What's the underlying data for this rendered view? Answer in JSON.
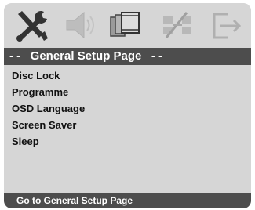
{
  "icons": [
    "tools-icon",
    "speaker-icon",
    "video-frames-icon",
    "grid-settings-icon",
    "exit-icon"
  ],
  "header": {
    "title": "- -   General Setup Page   - -"
  },
  "menu": {
    "items": [
      {
        "label": "Disc Lock"
      },
      {
        "label": "Programme"
      },
      {
        "label": "OSD Language"
      },
      {
        "label": "Screen Saver"
      },
      {
        "label": "Sleep"
      }
    ]
  },
  "footer": {
    "text": "Go to General Setup Page"
  },
  "colors": {
    "background": "#d6d6d6",
    "bar": "#4d4d4d",
    "bar_text": "#ffffff",
    "item_text": "#111111"
  }
}
